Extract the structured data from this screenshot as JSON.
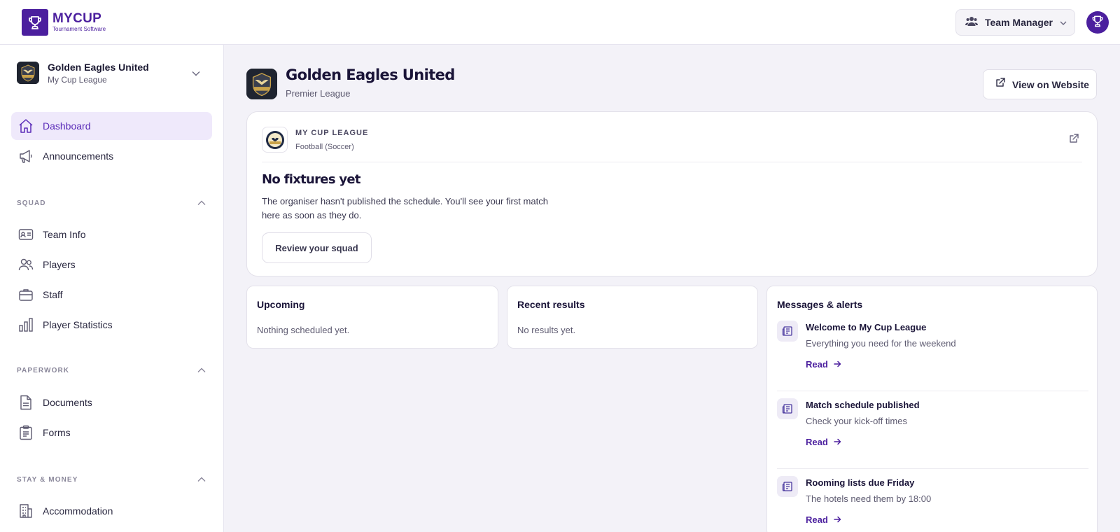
{
  "brand": {
    "name": "MYCUP",
    "tagline": "Tournament Software",
    "color": "#4b1f9e"
  },
  "header": {
    "role_label": "Team Manager"
  },
  "team_switcher": {
    "team": "Golden Eagles United",
    "league": "My Cup League"
  },
  "sidebar": {
    "items": [
      {
        "label": "Dashboard",
        "icon": "home-icon",
        "active": true
      },
      {
        "label": "Announcements",
        "icon": "megaphone-icon"
      }
    ],
    "sections": [
      {
        "label": "SQUAD",
        "items": [
          {
            "label": "Team Info",
            "icon": "id-card-icon"
          },
          {
            "label": "Players",
            "icon": "users-icon"
          },
          {
            "label": "Staff",
            "icon": "briefcase-icon"
          },
          {
            "label": "Player Statistics",
            "icon": "bar-chart-icon"
          }
        ]
      },
      {
        "label": "PAPERWORK",
        "items": [
          {
            "label": "Documents",
            "icon": "document-icon"
          },
          {
            "label": "Forms",
            "icon": "clipboard-icon"
          }
        ]
      },
      {
        "label": "STAY & MONEY",
        "items": [
          {
            "label": "Accommodation",
            "icon": "building-icon"
          }
        ]
      }
    ]
  },
  "page": {
    "title": "Golden Eagles United",
    "subtitle": "Premier League",
    "website_button": "View on Website"
  },
  "hero": {
    "league_name": "MY CUP LEAGUE",
    "sport": "Football (Soccer)",
    "title": "No fixtures yet",
    "text": "The organiser hasn't published the schedule. You'll see your first match here as soon as they do.",
    "button": "Review your squad"
  },
  "upcoming": {
    "title": "Upcoming",
    "empty": "Nothing scheduled yet."
  },
  "results": {
    "title": "Recent results",
    "empty": "No results yet."
  },
  "messages": {
    "title": "Messages & alerts",
    "read_label": "Read",
    "items": [
      {
        "title": "Welcome to My Cup League",
        "subtitle": "Everything you need for the weekend"
      },
      {
        "title": "Match schedule published",
        "subtitle": "Check your kick-off times"
      },
      {
        "title": "Rooming lists due Friday",
        "subtitle": "The hotels need them by 18:00"
      }
    ]
  }
}
